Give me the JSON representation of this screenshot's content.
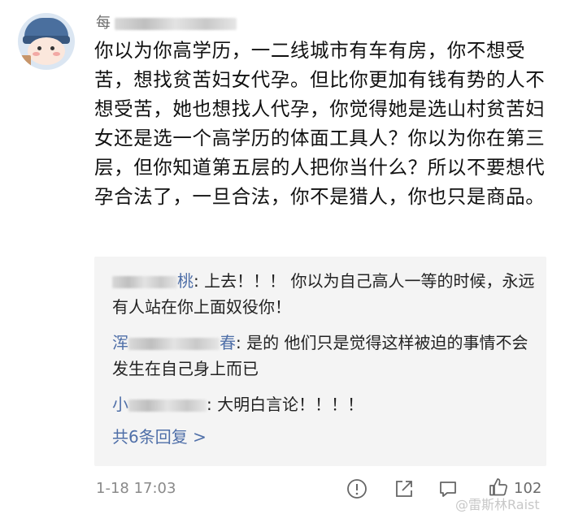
{
  "comment": {
    "username_visible_prefix": "每",
    "username_visible_suffix": "",
    "body": "你以为你高学历，一二线城市有车有房，你不想受苦，想找贫苦妇女代孕。但比你更加有钱有势的人不想受苦，她也想找人代孕，你觉得她是选山村贫苦妇女还是选一个高学历的体面工具人？你以为你在第三层，但你知道第五层的人把你当什么？所以不要想代孕合法了，一旦合法，你不是猎人，你也只是商品。",
    "time": "1-18 17:03",
    "like_count": "102"
  },
  "replies": [
    {
      "name_visible": "桃",
      "separator": ": ",
      "text": "上去！！！ 你以为自己高人一等的时候，永远有人站在你上面奴役你！"
    },
    {
      "name_visible_prefix": "浑",
      "name_visible_suffix": "春",
      "separator": ": ",
      "text": "是的 他们只是觉得这样被迫的事情不会发生在自己身上而已"
    },
    {
      "name_visible_prefix": "小",
      "separator": ": ",
      "text": "大明白言论！！！！"
    }
  ],
  "more_replies_label": "共6条回复 >",
  "watermark": "@雷斯林Raist",
  "icons": [
    "avatar",
    "report-icon",
    "share-icon",
    "comment-icon",
    "like-icon"
  ]
}
